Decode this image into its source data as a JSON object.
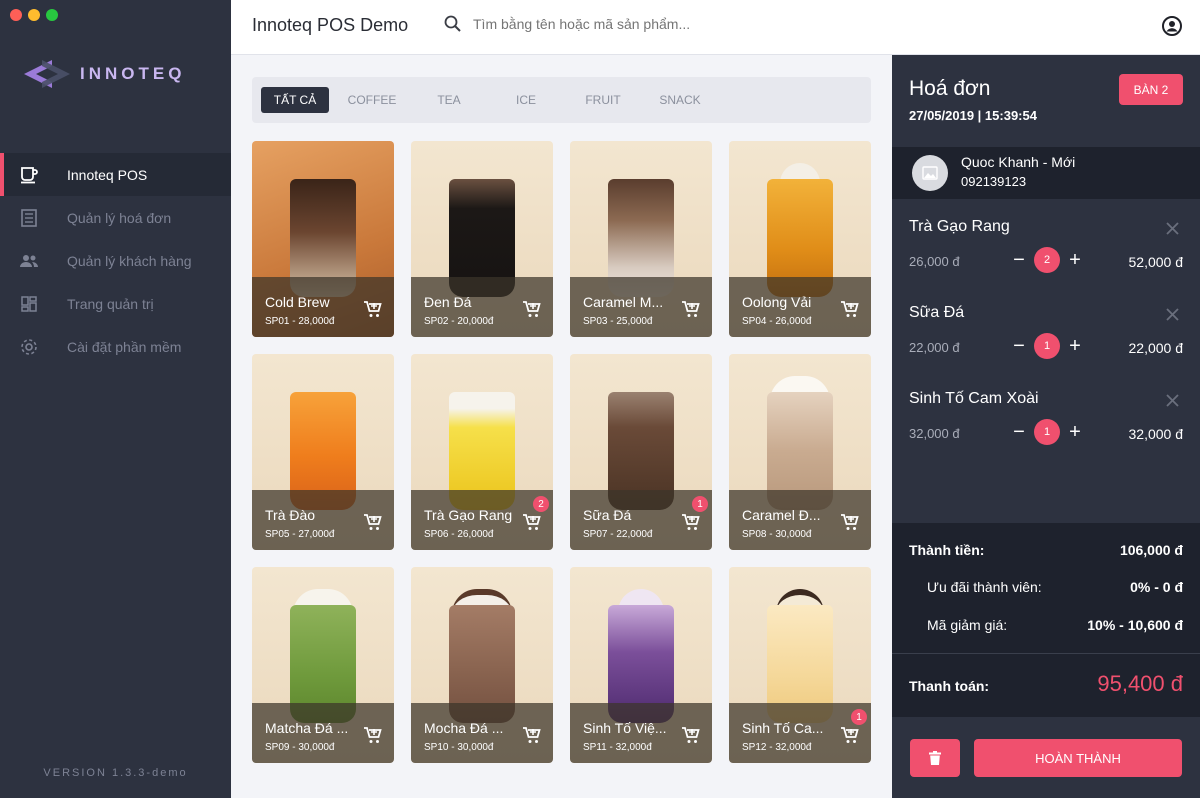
{
  "app": {
    "title": "Innoteq POS Demo",
    "brand": "INNOTEQ",
    "version": "VERSION 1.3.3-demo",
    "accent": "#f0506e"
  },
  "search": {
    "placeholder": "Tìm bằng tên hoặc mã sản phẩm..."
  },
  "sidebar": {
    "items": [
      {
        "label": "Innoteq POS",
        "icon": "coffee-cup-icon",
        "active": true
      },
      {
        "label": "Quản lý hoá đơn",
        "icon": "receipt-icon",
        "active": false
      },
      {
        "label": "Quản lý khách hàng",
        "icon": "people-icon",
        "active": false
      },
      {
        "label": "Trang quản trị",
        "icon": "dashboard-icon",
        "active": false
      },
      {
        "label": "Cài đặt phần mềm",
        "icon": "gear-icon",
        "active": false
      }
    ]
  },
  "tabs": [
    "TẤT CẢ",
    "COFFEE",
    "TEA",
    "ICE",
    "FRUIT",
    "SNACK"
  ],
  "products": [
    {
      "name": "Cold Brew",
      "sub": "SP01 - 28,000đ",
      "badge": ""
    },
    {
      "name": "Đen Đá",
      "sub": "SP02 - 20,000đ",
      "badge": ""
    },
    {
      "name": "Caramel M...",
      "sub": "SP03 - 25,000đ",
      "badge": ""
    },
    {
      "name": "Oolong Vải",
      "sub": "SP04 - 26,000đ",
      "badge": ""
    },
    {
      "name": "Trà Đào",
      "sub": "SP05 - 27,000đ",
      "badge": ""
    },
    {
      "name": "Trà Gạo Rang",
      "sub": "SP06 - 26,000đ",
      "badge": "2"
    },
    {
      "name": "Sữa Đá",
      "sub": "SP07 - 22,000đ",
      "badge": "1"
    },
    {
      "name": "Caramel Đ...",
      "sub": "SP08 - 30,000đ",
      "badge": ""
    },
    {
      "name": "Matcha Đá ...",
      "sub": "SP09 - 30,000đ",
      "badge": ""
    },
    {
      "name": "Mocha Đá ...",
      "sub": "SP10 - 30,000đ",
      "badge": ""
    },
    {
      "name": "Sinh Tố Việ...",
      "sub": "SP11 - 32,000đ",
      "badge": ""
    },
    {
      "name": "Sinh Tố Ca...",
      "sub": "SP12 - 32,000đ",
      "badge": "1"
    }
  ],
  "invoice": {
    "title": "Hoá đơn",
    "datetime": "27/05/2019 | 15:39:54",
    "table": "BÀN 2",
    "customer": {
      "name": "Quoc Khanh - Mới",
      "phone": "092139123"
    },
    "items": [
      {
        "name": "Trà Gạo Rang",
        "price": "26,000 đ",
        "qty": "2",
        "total": "52,000 đ"
      },
      {
        "name": "Sữa Đá",
        "price": "22,000 đ",
        "qty": "1",
        "total": "22,000 đ"
      },
      {
        "name": "Sinh Tố Cam Xoài",
        "price": "32,000 đ",
        "qty": "1",
        "total": "32,000 đ"
      }
    ],
    "subtotal_label": "Thành tiền:",
    "subtotal": "106,000 đ",
    "member_label": "Ưu đãi thành viên:",
    "member": "0% - 0 đ",
    "coupon_label": "Mã giảm giá:",
    "coupon": "10% - 10,600 đ",
    "pay_label": "Thanh toán:",
    "pay": "95,400 đ",
    "done_label": "HOÀN THÀNH"
  }
}
